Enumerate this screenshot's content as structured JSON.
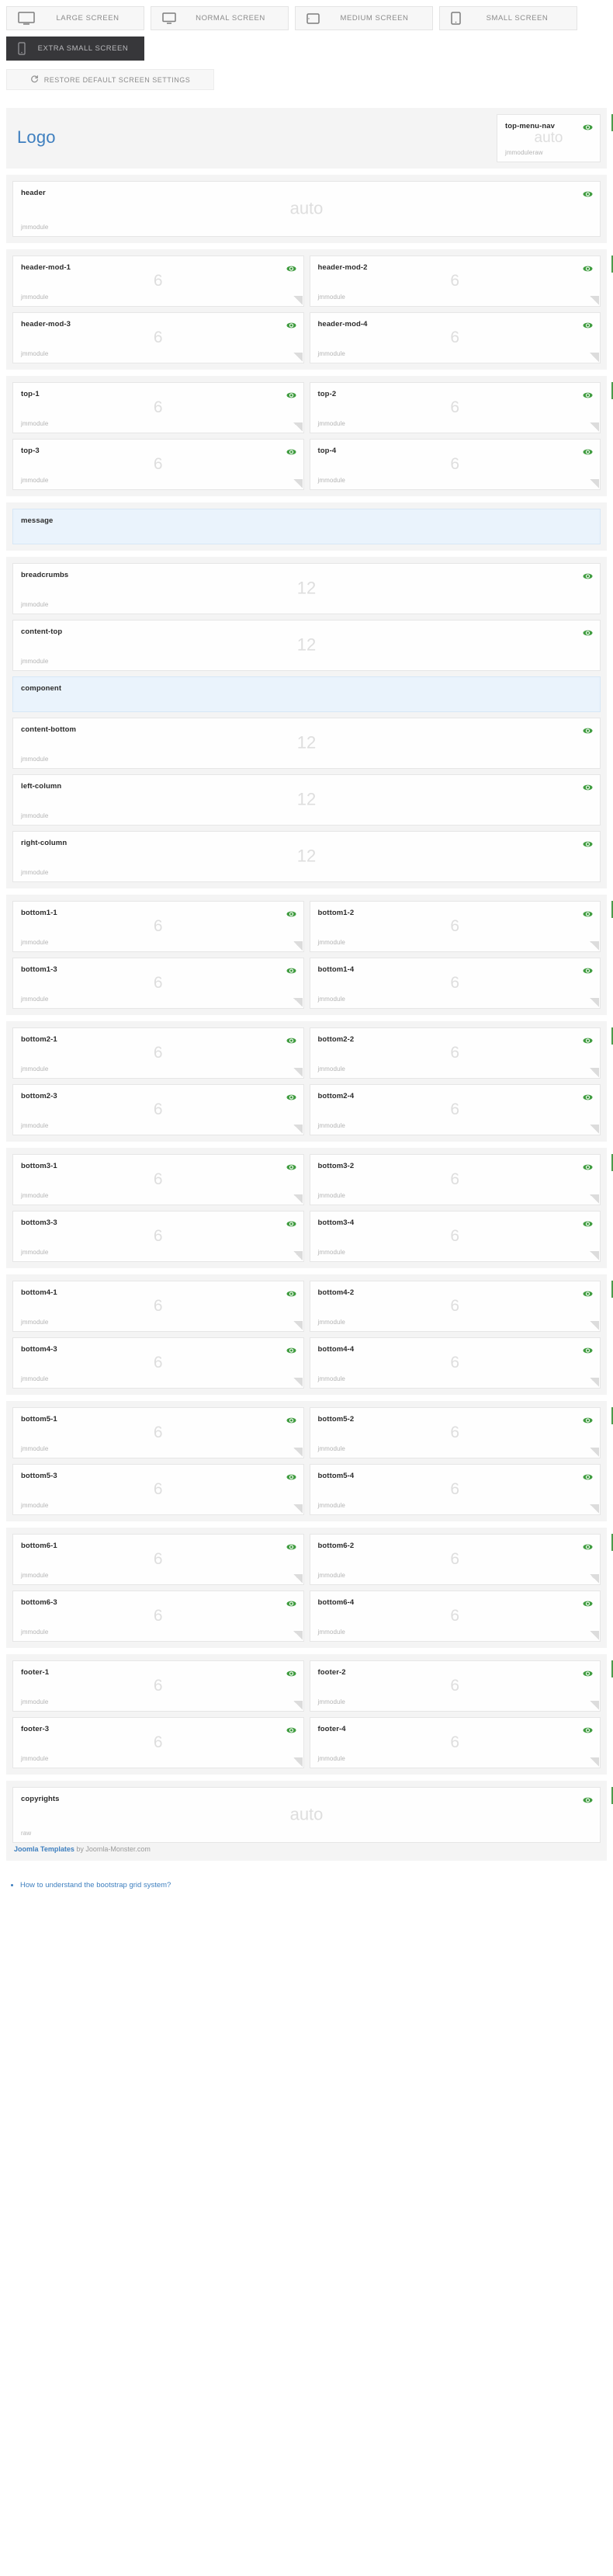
{
  "toolbar": {
    "screens": [
      {
        "label": "LARGE SCREEN",
        "icon": "monitor-large-icon",
        "active": false
      },
      {
        "label": "NORMAL SCREEN",
        "icon": "monitor-normal-icon",
        "active": false
      },
      {
        "label": "MEDIUM SCREEN",
        "icon": "tablet-landscape-icon",
        "active": false
      },
      {
        "label": "SMALL SCREEN",
        "icon": "tablet-portrait-icon",
        "active": false
      },
      {
        "label": "EXTRA SMALL SCREEN",
        "icon": "phone-icon",
        "active": true
      }
    ],
    "restore_label": "RESTORE DEFAULT SCREEN SETTINGS",
    "restore_icon": "refresh-icon",
    "active_screen": "EXTRA SMALL SCREEN"
  },
  "colors": {
    "accent_green": "#4b9b4b",
    "link_blue": "#3e7fbf",
    "highlight_bg": "#eaf3fc",
    "section_bg": "#f4f4f4",
    "active_btn_bg": "#37373a"
  },
  "layout": {
    "logo_text": "Logo",
    "sections": [
      {
        "name": "logo-nav-section",
        "kind": "brand",
        "toggle": true,
        "rows": [
          [
            {
              "title": "Logo",
              "kind": "logo"
            },
            {
              "title": "top-menu-nav",
              "size": "auto",
              "type": "jmmoduleraw",
              "eye": true,
              "kind": "nav"
            }
          ]
        ]
      },
      {
        "name": "header-section",
        "toggle": false,
        "rows": [
          [
            {
              "title": "header",
              "size": "auto",
              "type": "jmmodule",
              "eye": true,
              "wide": true
            }
          ]
        ]
      },
      {
        "name": "header-mod-section",
        "toggle": true,
        "rows": [
          [
            {
              "title": "header-mod-1",
              "size": "6",
              "type": "jmmodule",
              "eye": true,
              "grip": true
            },
            {
              "title": "header-mod-2",
              "size": "6",
              "type": "jmmodule",
              "eye": true,
              "grip": true
            }
          ],
          [
            {
              "title": "header-mod-3",
              "size": "6",
              "type": "jmmodule",
              "eye": true,
              "grip": true
            },
            {
              "title": "header-mod-4",
              "size": "6",
              "type": "jmmodule",
              "eye": true,
              "grip": true
            }
          ]
        ]
      },
      {
        "name": "top-section",
        "toggle": true,
        "rows": [
          [
            {
              "title": "top-1",
              "size": "6",
              "type": "jmmodule",
              "eye": true,
              "grip": true
            },
            {
              "title": "top-2",
              "size": "6",
              "type": "jmmodule",
              "eye": true,
              "grip": true
            }
          ],
          [
            {
              "title": "top-3",
              "size": "6",
              "type": "jmmodule",
              "eye": true,
              "grip": true
            },
            {
              "title": "top-4",
              "size": "6",
              "type": "jmmodule",
              "eye": true,
              "grip": true
            }
          ]
        ]
      },
      {
        "name": "message-section",
        "toggle": false,
        "rows": [
          [
            {
              "title": "message",
              "highlight": true
            }
          ]
        ]
      },
      {
        "name": "content-section",
        "toggle": false,
        "rows": [
          [
            {
              "title": "breadcrumbs",
              "size": "12",
              "type": "jmmodule",
              "eye": true,
              "wide": true
            }
          ],
          [
            {
              "title": "content-top",
              "size": "12",
              "type": "jmmodule",
              "eye": true,
              "wide": true
            }
          ],
          [
            {
              "title": "component",
              "highlight": true
            }
          ],
          [
            {
              "title": "content-bottom",
              "size": "12",
              "type": "jmmodule",
              "eye": true,
              "wide": true
            }
          ],
          [
            {
              "title": "left-column",
              "size": "12",
              "type": "jmmodule",
              "eye": true,
              "wide": true
            }
          ],
          [
            {
              "title": "right-column",
              "size": "12",
              "type": "jmmodule",
              "eye": true,
              "wide": true
            }
          ]
        ]
      },
      {
        "name": "bottom1-section",
        "toggle": true,
        "rows": [
          [
            {
              "title": "bottom1-1",
              "size": "6",
              "type": "jmmodule",
              "eye": true,
              "grip": true
            },
            {
              "title": "bottom1-2",
              "size": "6",
              "type": "jmmodule",
              "eye": true,
              "grip": true
            }
          ],
          [
            {
              "title": "bottom1-3",
              "size": "6",
              "type": "jmmodule",
              "eye": true,
              "grip": true
            },
            {
              "title": "bottom1-4",
              "size": "6",
              "type": "jmmodule",
              "eye": true,
              "grip": true
            }
          ]
        ]
      },
      {
        "name": "bottom2-section",
        "toggle": true,
        "rows": [
          [
            {
              "title": "bottom2-1",
              "size": "6",
              "type": "jmmodule",
              "eye": true,
              "grip": true
            },
            {
              "title": "bottom2-2",
              "size": "6",
              "type": "jmmodule",
              "eye": true,
              "grip": true
            }
          ],
          [
            {
              "title": "bottom2-3",
              "size": "6",
              "type": "jmmodule",
              "eye": true,
              "grip": true
            },
            {
              "title": "bottom2-4",
              "size": "6",
              "type": "jmmodule",
              "eye": true,
              "grip": true
            }
          ]
        ]
      },
      {
        "name": "bottom3-section",
        "toggle": true,
        "rows": [
          [
            {
              "title": "bottom3-1",
              "size": "6",
              "type": "jmmodule",
              "eye": true,
              "grip": true
            },
            {
              "title": "bottom3-2",
              "size": "6",
              "type": "jmmodule",
              "eye": true,
              "grip": true
            }
          ],
          [
            {
              "title": "bottom3-3",
              "size": "6",
              "type": "jmmodule",
              "eye": true,
              "grip": true
            },
            {
              "title": "bottom3-4",
              "size": "6",
              "type": "jmmodule",
              "eye": true,
              "grip": true
            }
          ]
        ]
      },
      {
        "name": "bottom4-section",
        "toggle": true,
        "rows": [
          [
            {
              "title": "bottom4-1",
              "size": "6",
              "type": "jmmodule",
              "eye": true,
              "grip": true
            },
            {
              "title": "bottom4-2",
              "size": "6",
              "type": "jmmodule",
              "eye": true,
              "grip": true
            }
          ],
          [
            {
              "title": "bottom4-3",
              "size": "6",
              "type": "jmmodule",
              "eye": true,
              "grip": true
            },
            {
              "title": "bottom4-4",
              "size": "6",
              "type": "jmmodule",
              "eye": true,
              "grip": true
            }
          ]
        ]
      },
      {
        "name": "bottom5-section",
        "toggle": true,
        "rows": [
          [
            {
              "title": "bottom5-1",
              "size": "6",
              "type": "jmmodule",
              "eye": true,
              "grip": true
            },
            {
              "title": "bottom5-2",
              "size": "6",
              "type": "jmmodule",
              "eye": true,
              "grip": true
            }
          ],
          [
            {
              "title": "bottom5-3",
              "size": "6",
              "type": "jmmodule",
              "eye": true,
              "grip": true
            },
            {
              "title": "bottom5-4",
              "size": "6",
              "type": "jmmodule",
              "eye": true,
              "grip": true
            }
          ]
        ]
      },
      {
        "name": "bottom6-section",
        "toggle": true,
        "rows": [
          [
            {
              "title": "bottom6-1",
              "size": "6",
              "type": "jmmodule",
              "eye": true,
              "grip": true
            },
            {
              "title": "bottom6-2",
              "size": "6",
              "type": "jmmodule",
              "eye": true,
              "grip": true
            }
          ],
          [
            {
              "title": "bottom6-3",
              "size": "6",
              "type": "jmmodule",
              "eye": true,
              "grip": true
            },
            {
              "title": "bottom6-4",
              "size": "6",
              "type": "jmmodule",
              "eye": true,
              "grip": true
            }
          ]
        ]
      },
      {
        "name": "footer-section",
        "toggle": true,
        "rows": [
          [
            {
              "title": "footer-1",
              "size": "6",
              "type": "jmmodule",
              "eye": true,
              "grip": true
            },
            {
              "title": "footer-2",
              "size": "6",
              "type": "jmmodule",
              "eye": true,
              "grip": true
            }
          ],
          [
            {
              "title": "footer-3",
              "size": "6",
              "type": "jmmodule",
              "eye": true,
              "grip": true
            },
            {
              "title": "footer-4",
              "size": "6",
              "type": "jmmodule",
              "eye": true,
              "grip": true
            }
          ]
        ]
      },
      {
        "name": "copyrights-section",
        "toggle": true,
        "credit": true,
        "rows": [
          [
            {
              "title": "copyrights",
              "size": "auto",
              "type": "raw",
              "eye": true,
              "wide": true
            }
          ]
        ]
      }
    ]
  },
  "credit": {
    "link_text": "Joomla Templates",
    "suffix_text": " by Joomla-Monster.com"
  },
  "help": {
    "items": [
      {
        "label": "How to understand the bootstrap grid system?"
      }
    ]
  }
}
